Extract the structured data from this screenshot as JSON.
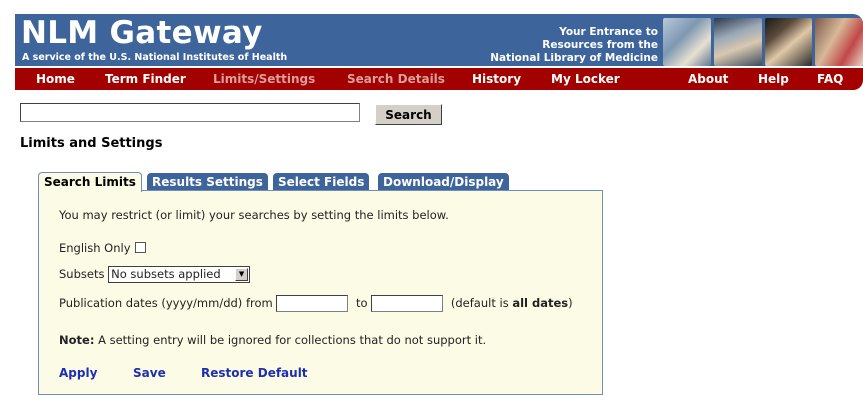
{
  "header": {
    "brand_title": "NLM Gateway",
    "brand_subtitle": "A service of the U.S. National Institutes of Health",
    "tagline": [
      "Your Entrance to",
      "Resources from the",
      "National Library of Medicine"
    ]
  },
  "nav": {
    "items": [
      {
        "label": "Home"
      },
      {
        "label": "Term Finder"
      },
      {
        "label": "Limits/Settings"
      },
      {
        "label": "Search Details"
      },
      {
        "label": "History"
      },
      {
        "label": "My Locker"
      },
      {
        "label": "About"
      },
      {
        "label": "Help"
      },
      {
        "label": "FAQ"
      }
    ]
  },
  "search": {
    "value": "",
    "button_label": "Search"
  },
  "page_title": "Limits and Settings",
  "tabs": [
    {
      "label": "Search Limits"
    },
    {
      "label": "Results Settings"
    },
    {
      "label": "Select Fields"
    },
    {
      "label": "Download/Display"
    }
  ],
  "panel": {
    "intro": "You may restrict (or limit) your searches by setting the limits below.",
    "english_only_label": "English Only",
    "subsets_label": "Subsets",
    "subsets_selected": "No subsets applied",
    "pubdates_label": "Publication dates (yyyy/mm/dd) from",
    "to_label": "to",
    "default_prefix": "(default is ",
    "default_strong": "all dates",
    "default_suffix": ")",
    "note_label": "Note:",
    "note_text": " A setting entry will be ignored for collections that do not support it.",
    "apply_label": "Apply",
    "save_label": "Save",
    "restore_label": "Restore Default"
  },
  "colors": {
    "banner_blue": "#3e659b",
    "nav_red": "#a30000",
    "panel_bg": "#fcfbe6",
    "link_blue": "#1d2fb0"
  }
}
